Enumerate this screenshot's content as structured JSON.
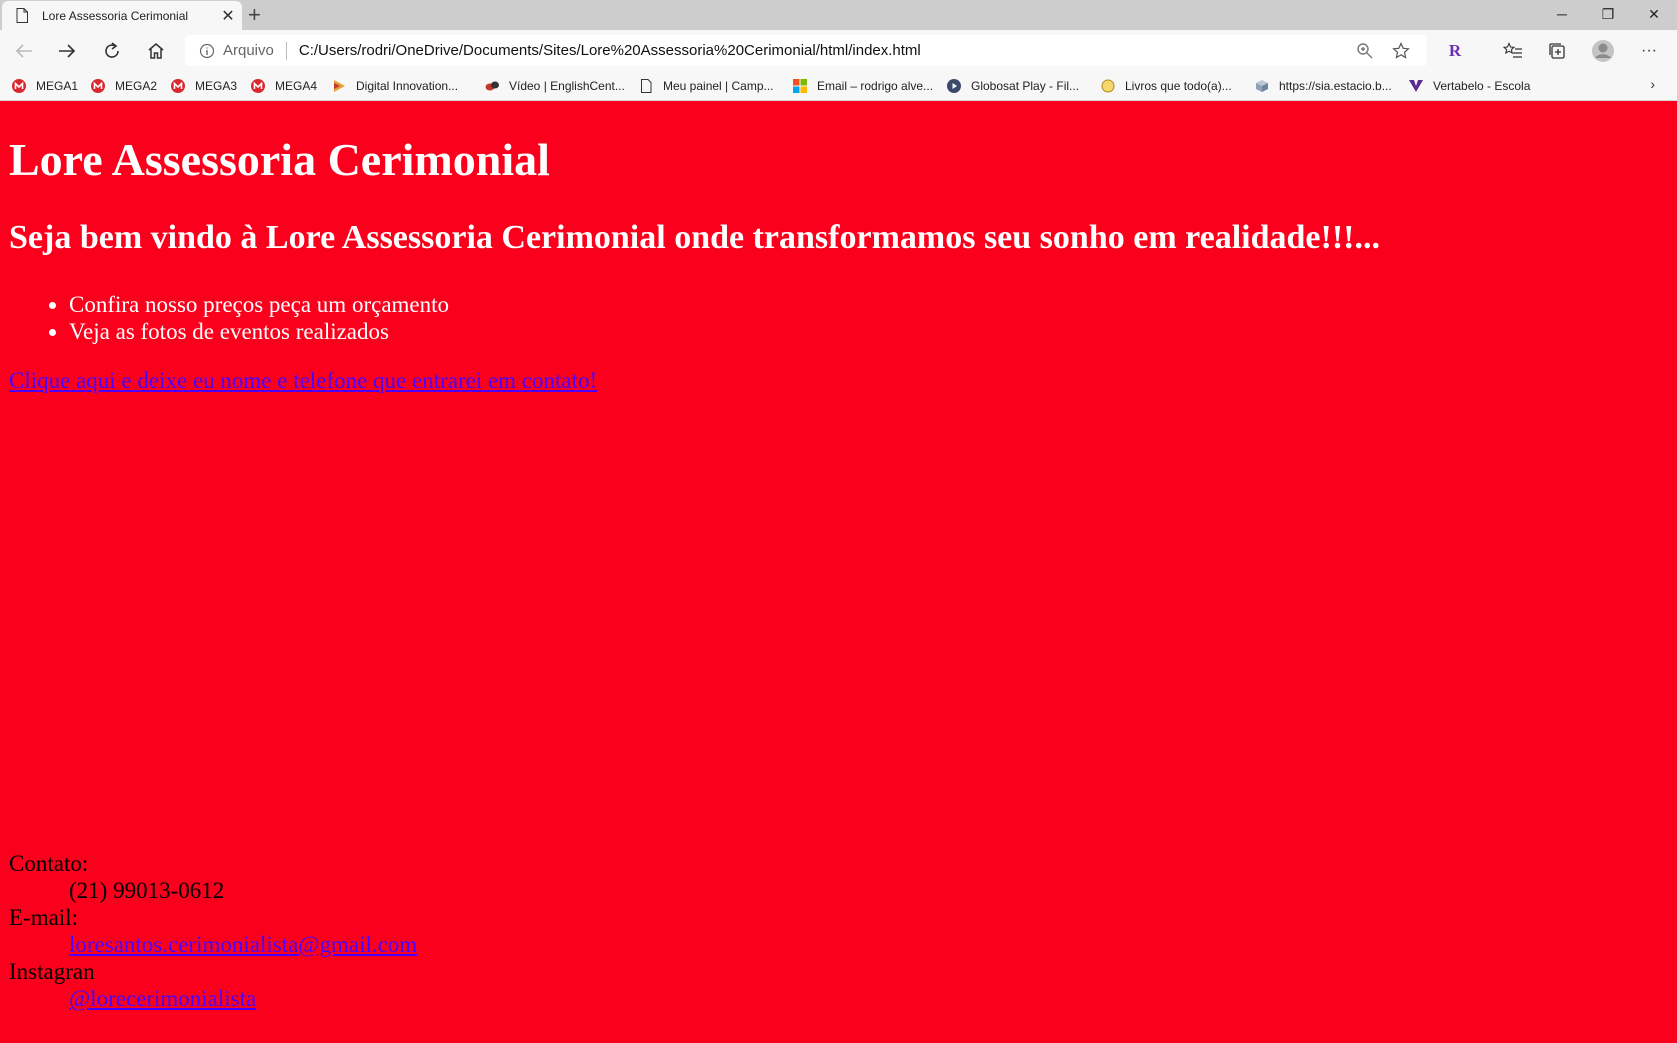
{
  "browser": {
    "tab_title": "Lore Assessoria Cerimonial",
    "new_tab_glyph": "+",
    "address": {
      "scheme_label": "Arquivo",
      "url": "C:/Users/rodri/OneDrive/Documents/Sites/Lore%20Assessoria%20Cerimonial/html/index.html"
    },
    "bookmarks": [
      {
        "label": "MEGA1",
        "icon": "mega-icon"
      },
      {
        "label": "MEGA2",
        "icon": "mega-icon"
      },
      {
        "label": "MEGA3",
        "icon": "mega-icon"
      },
      {
        "label": "MEGA4",
        "icon": "mega-icon"
      },
      {
        "label": "Digital Innovation...",
        "icon": "dio-icon"
      },
      {
        "label": "Vídeo | EnglishCent...",
        "icon": "englishcentral-icon"
      },
      {
        "label": "Meu painel | Camp...",
        "icon": "page-icon"
      },
      {
        "label": "Email – rodrigo alve...",
        "icon": "microsoft-icon"
      },
      {
        "label": "Globosat Play - Fil...",
        "icon": "play-icon"
      },
      {
        "label": "Livros que todo(a)...",
        "icon": "circle-icon"
      },
      {
        "label": "https://sia.estacio.b...",
        "icon": "cube-icon"
      },
      {
        "label": "Vertabelo - Escola",
        "icon": "vertabelo-icon"
      }
    ],
    "colors": {
      "mega": "#d9272e",
      "chrome_bg": "#f7f7f7",
      "tabstrip_bg": "#cdcdcd"
    }
  },
  "page": {
    "heading": "Lore Assessoria Cerimonial",
    "subheading": "Seja bem vindo à Lore Assessoria Cerimonial onde transformamos seu sonho em realidade!!!...",
    "list_items": [
      "Confira nosso preços peça um orçamento",
      "Veja as fotos de eventos realizados"
    ],
    "cta_link": "Clique aqui e deixe eu nome e telefone que entrarei em contato!",
    "contact": {
      "phone_label": "Contato:",
      "phone": "(21) 99013-0612",
      "email_label": "E-mail:",
      "email": "loresantos.cerimonialista@gmail.com",
      "instagram_label": "Instagran",
      "instagram": "@lorecerimonialista"
    },
    "colors": {
      "background": "#fb001c",
      "heading": "#ffffff",
      "link": "#4b00ff"
    }
  }
}
